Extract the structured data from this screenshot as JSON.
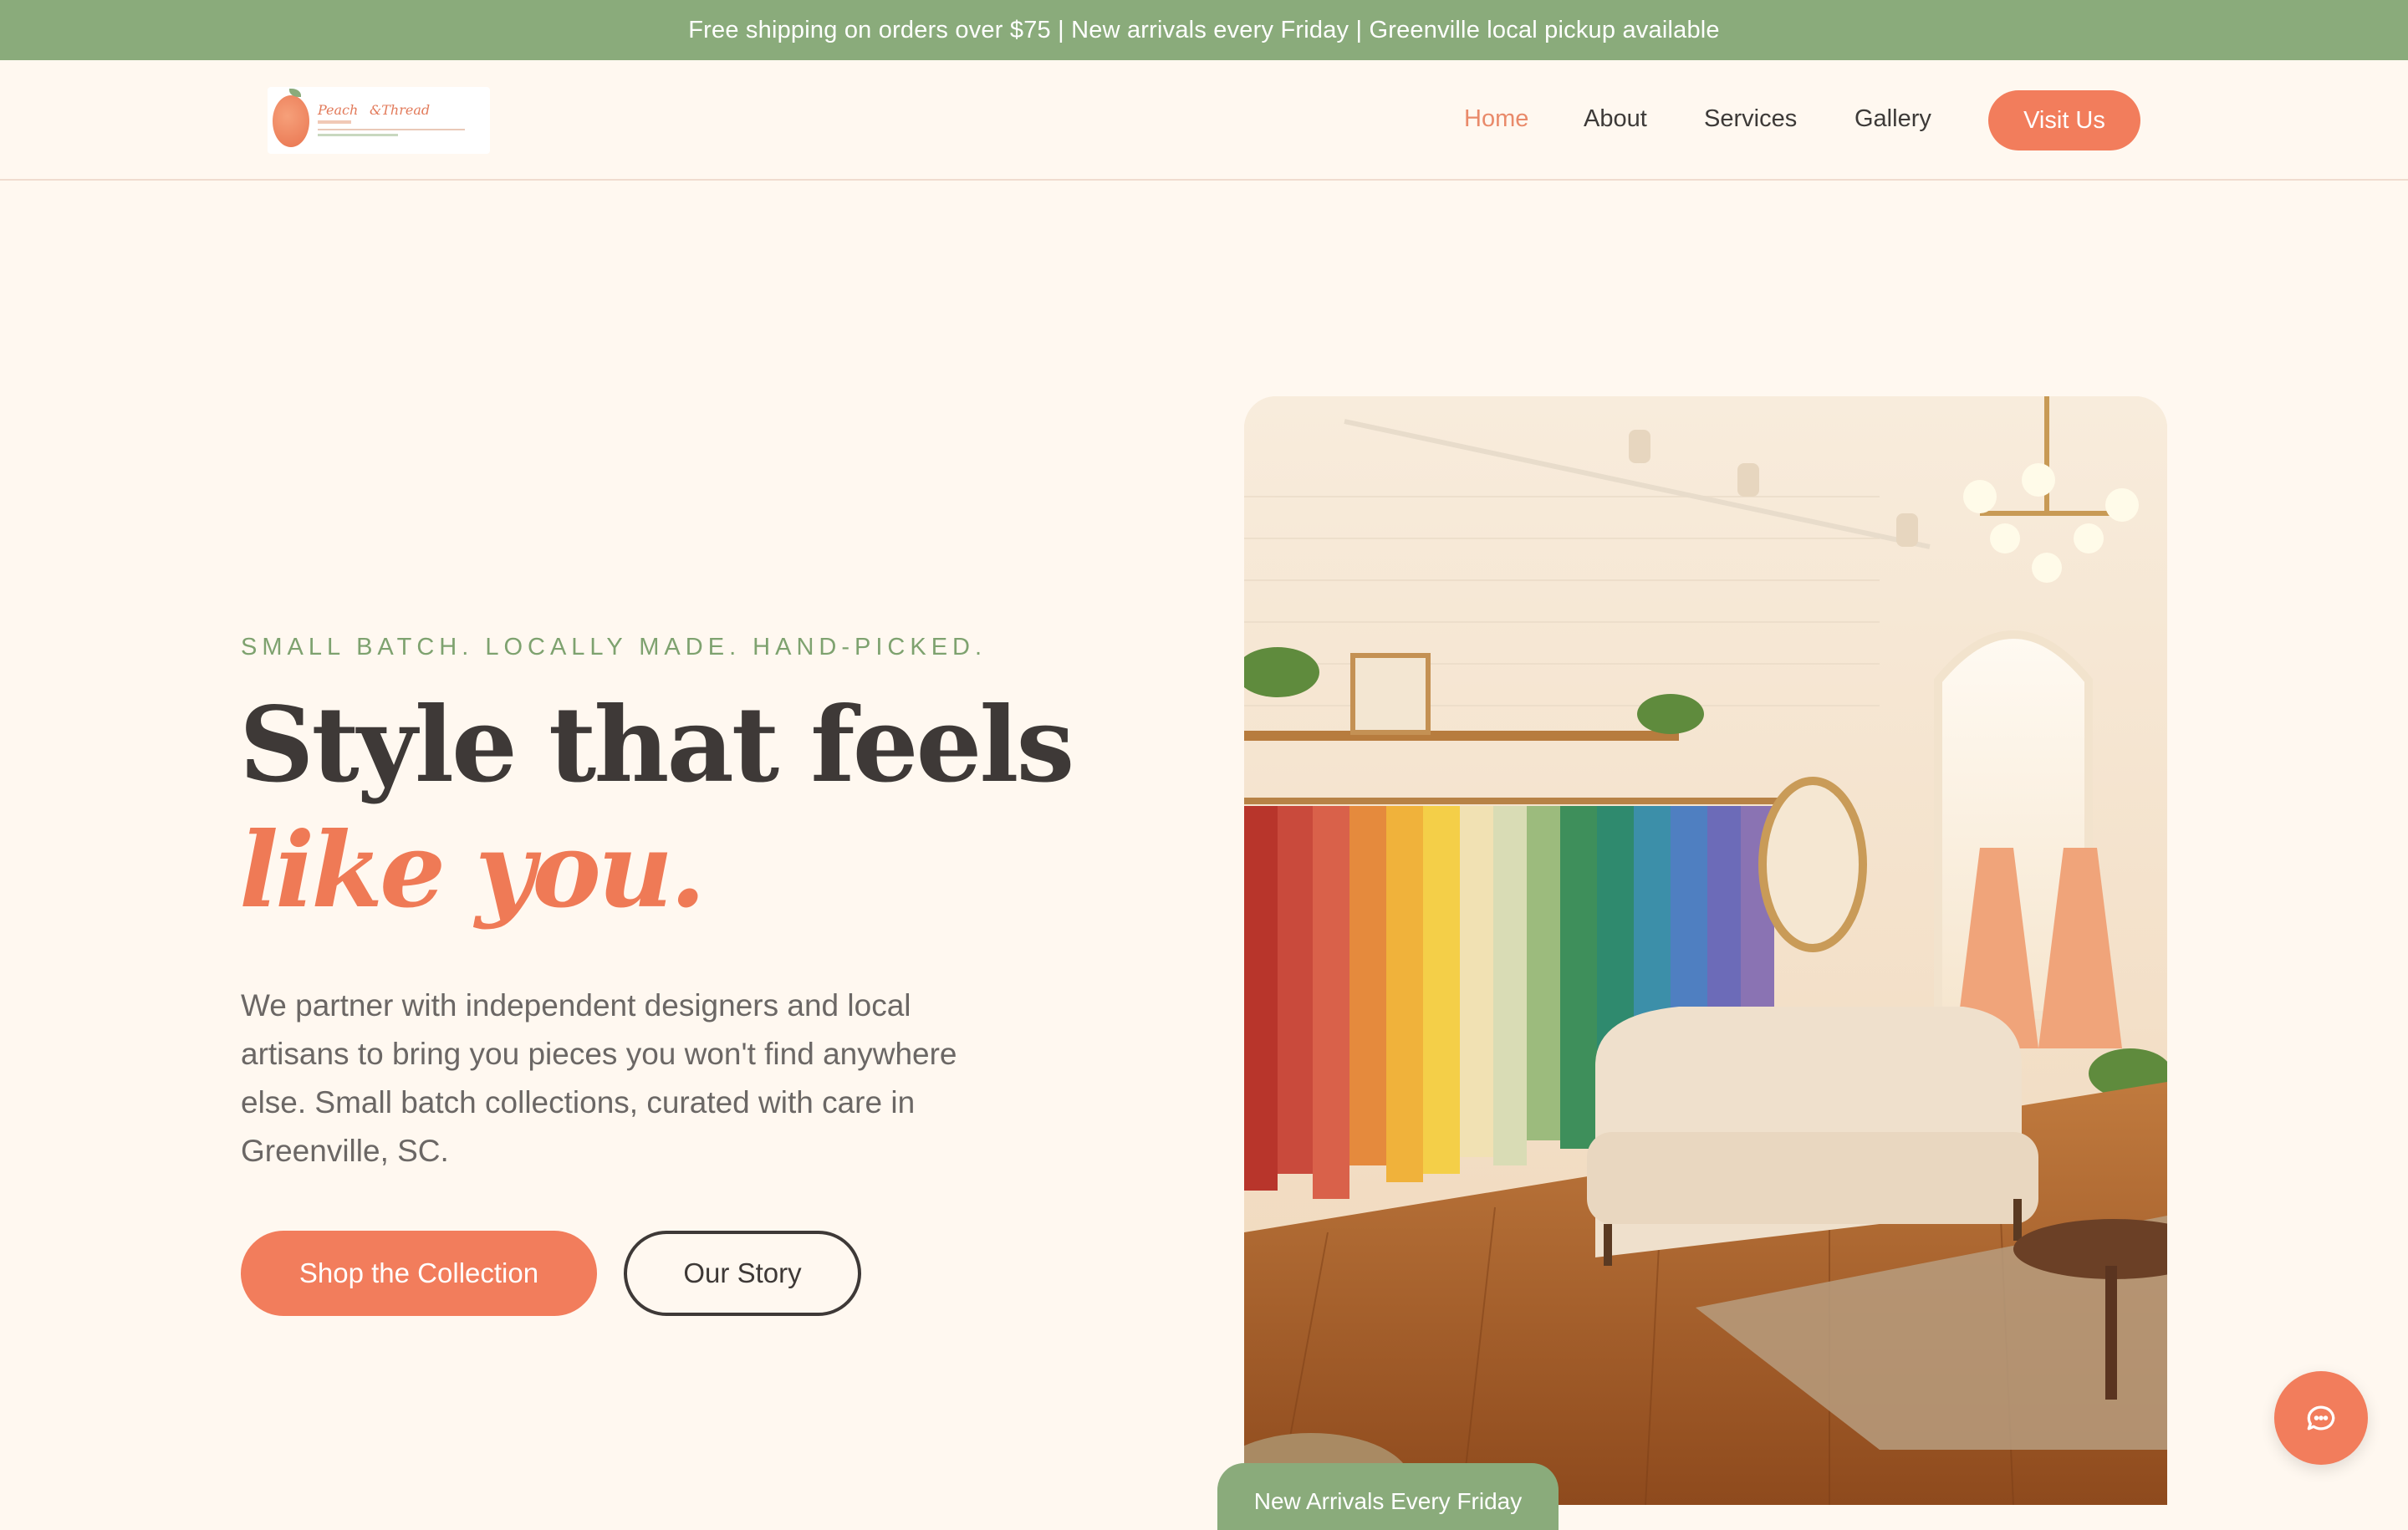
{
  "announcement": {
    "text": "Free shipping on orders over $75 | New arrivals every Friday | Greenville local pickup available"
  },
  "header": {
    "logo": {
      "word1": "Peach",
      "word2": "&Thread"
    },
    "nav": [
      {
        "label": "Home",
        "active": true
      },
      {
        "label": "About",
        "active": false
      },
      {
        "label": "Services",
        "active": false
      },
      {
        "label": "Gallery",
        "active": false
      }
    ],
    "cta_label": "Visit Us"
  },
  "hero": {
    "eyebrow": "SMALL BATCH. LOCALLY MADE. HAND-PICKED.",
    "title_line1": "Style that feels",
    "title_line2": "like you.",
    "lead": "We partner with independent designers and local artisans to bring you pieces you won't find anywhere else. Small batch collections, curated with care in Greenville, SC.",
    "primary_button": "Shop the Collection",
    "secondary_button": "Our Story",
    "badge": "New Arrivals Every Friday",
    "image_icon": "boutique-interior-photo"
  },
  "chat": {
    "icon": "chat-bubble-icon"
  },
  "colors": {
    "accent": "#f27d5c",
    "green": "#8aab7b",
    "background": "#fff8f0",
    "heading": "#3e3937"
  }
}
